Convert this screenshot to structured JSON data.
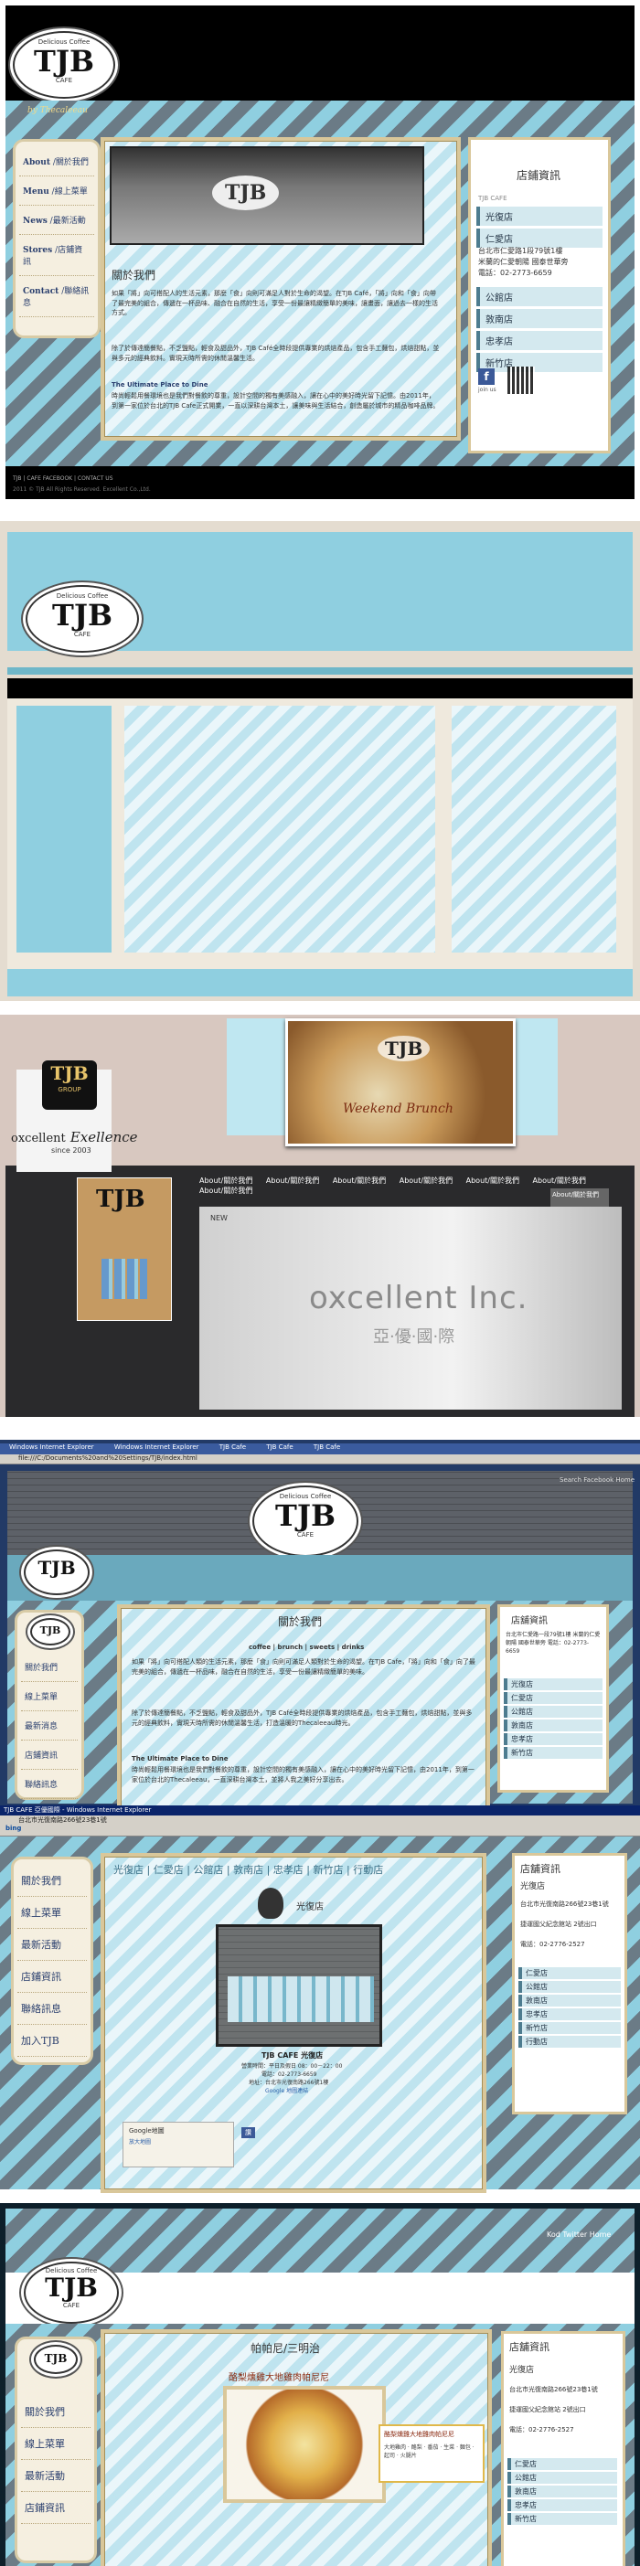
{
  "s1": {
    "logo": {
      "top": "Delicious Coffee",
      "name": "TJB",
      "sub": "CAFE"
    },
    "tagline": "by Thecaleeau",
    "nav": [
      {
        "main": "About",
        "sub": "關於我們"
      },
      {
        "main": "Menu",
        "sub": "線上菜單"
      },
      {
        "main": "News",
        "sub": "最新活動"
      },
      {
        "main": "Stores",
        "sub": "店鋪資訊"
      },
      {
        "main": "Contact",
        "sub": "聯絡訊息"
      }
    ],
    "photo_logo": "TJB",
    "about_title": "關於我們",
    "about_p1": "如果「將」向可搭配人的生活元素，那麼「食」向則可滿足人對於生命的渴望。在TJB Café，「將」向和「食」向帶了最完美的組合，傳遞在一杯品味、融合在自然的生活，享受一份最讓精緻簡單的美味，讓畫面，讓過去一樣的生活方式。",
    "about_p2": "除了於傳達簡餐點，不乏鹽點，輕食及甜品外，TJB Café全時段提供專業的烘焙產品，包含手工麵包，烘焙甜點，並與多元的經典飲料。實現天時所需的休閒溫馨生活。",
    "about_subtitle": "The Ultimate Place to Dine",
    "about_p3": "時尚輕鬆用餐環境也是我們對餐飲的尊重，設計空間的獨有美感融入，讓在心中的美好時光留下記憶。由2011年，到第一家位於台北的TJB Cafe正式開業，一直以深耕台灣本土，讓美味與生活結合，創造屬於城市的精品咖啡品牌。",
    "store_title": "店鋪資訊",
    "cafe_label": "TJB CAFE",
    "stores_a": [
      "光復店",
      "仁愛店"
    ],
    "address": "台北市仁愛路1段79號1樓",
    "address2": "米蘭的仁愛朝陽 國泰世華旁",
    "phone": "電話：02-2773-6659",
    "stores_b": [
      "公館店",
      "敦南店",
      "忠孝店",
      "新竹店"
    ],
    "fb_label": "join us",
    "footer1": "TJB | CAFE FACEBOOK | CONTACT US",
    "footer2": "2011 © TJB All Rights Reserved. Excellent Co.,Ltd."
  },
  "s2": {
    "logo": {
      "top": "Delicious Coffee",
      "name": "TJB",
      "sub": "CAFE"
    }
  },
  "s3": {
    "group_name": "TJB",
    "group_sub": "GROUP",
    "excellence_a": "oxcellent",
    "excellence_b": "Exellence",
    "since": "since 2003",
    "banner_logo": "TJB",
    "banner_script": "Weekend Brunch",
    "card_logo": "TJB",
    "nav": [
      "About/關於我們",
      "About/關於我們",
      "About/關於我們",
      "About/關於我們",
      "About/關於我們",
      "About/關於我們",
      "About/關於我們"
    ],
    "dropdown": "About/關於我們",
    "new_label": "NEW",
    "wall_sign": "oxcellent Inc.",
    "wall_sign_cn": "亞·優·國·際"
  },
  "s4": {
    "browser_tabs": [
      "Windows Internet Explorer",
      "Windows Internet Explorer",
      "TJB Cafe",
      "TJB Cafe",
      "TJB Cafe"
    ],
    "address": "file:///C:/Documents%20and%20Settings/TJB/index.html",
    "logo": {
      "top": "Delicious Coffee",
      "name": "TJB",
      "sub": "CAFE"
    },
    "toplinks": "Search  Facebook  Home",
    "about_title": "關於我們",
    "about_sub": "coffee | brunch | sweets | drinks",
    "about_p1": "如果「將」向可搭配人類的生活元素，那麼「食」向則可滿足人類對於生命的渴望。在TJB Cafe，「將」向和「食」向了最完美的組合，傳遞在一杯品味，融合在自然的生活，享受一份最讓精緻簡單的美味。",
    "about_p2": "除了於傳達簡餐點，不乏鹽點，輕食及甜品外，TJB Café全時段提供專業的烘焙產品，包含手工麵包，烘焙甜點，並與多元的經典飲料，實現天時所需的休閒溫馨生活，打造溫暖的Thecaleeau時光。",
    "about_subtitle": "The Ultimate Place to Dine",
    "about_p3": "時尚輕鬆用餐環境也是我們對餐飲的尊重，設計空間的獨有美感融入，讓在心中的美好時光留下記憶，由2011年，到第一家位於台北的Thecaleeau，一直深耕台灣本土，並將人我之美好分享出去。",
    "nav": [
      "關於我們",
      "線上菜單",
      "最新消息",
      "店鋪資訊",
      "聯絡訊息"
    ],
    "store_title": "店舖資訊",
    "store_text": "台北市仁愛路一段79號1樓 米蘭的仁愛朝陽 國泰世華旁 電話：02-2773-6659",
    "stores": [
      "光復店",
      "仁愛店",
      "公館店",
      "敦南店",
      "忠孝店",
      "新竹店"
    ]
  },
  "s5": {
    "browser_title": "TJB CAFE 亞優國際 - Windows Internet Explorer",
    "address": "台北市光復南路266號23巷1號",
    "bing": "bing",
    "nav": [
      "關於我們",
      "線上菜單",
      "最新活動",
      "店鋪資訊",
      "聯絡訊息",
      "加入TJB"
    ],
    "store_tabs": "光復店 | 仁愛店 | 公館店 | 敦南店 | 忠孝店 | 新竹店 | 行動店",
    "store_name": "光復店",
    "caption_title": "TJB CAFE 光復店",
    "caption_lines": [
      "營業時間：平日及假日 08：00－22：00",
      "電話：02-2773-6659",
      "地址：台北市光復南路266號1樓",
      "Google 地圖連結"
    ],
    "map_label": "Google地圖",
    "map_sub": "放大地圖",
    "fb_label": "讚",
    "store_title": "店舖資訊",
    "current": "光復店",
    "address2": "捷運國父紀念館站 2號出口",
    "phone": "電話：02-2776-2527",
    "stores": [
      "仁愛店",
      "公館店",
      "敦南店",
      "忠孝店",
      "新竹店",
      "行動店"
    ]
  },
  "s6": {
    "toplinks": "Kod  Twitter  Home",
    "logo": {
      "top": "Delicious Coffee",
      "name": "TJB",
      "sub": "CAFE"
    },
    "nav": [
      "關於我們",
      "線上菜單",
      "最新活動",
      "店鋪資訊"
    ],
    "item_title": "帕帕尼/三明治",
    "item_sub": "酪梨燻雞大地雞肉帕尼尼",
    "note_title": "酪梨燻雞大地雞肉帕尼尼",
    "note_text": "大地雞肉 · 酪梨 · 番茄 · 生菜 · 麵包 · 起司 · 火腿片",
    "store_title": "店舖資訊",
    "current": "光復店",
    "address": "台北市光復南路266號23巷1號",
    "address2": "捷運國父紀念館站 2號出口",
    "phone": "電話：02-2776-2527",
    "stores": [
      "仁愛店",
      "公館店",
      "敦南店",
      "忠孝店",
      "新竹店"
    ]
  }
}
